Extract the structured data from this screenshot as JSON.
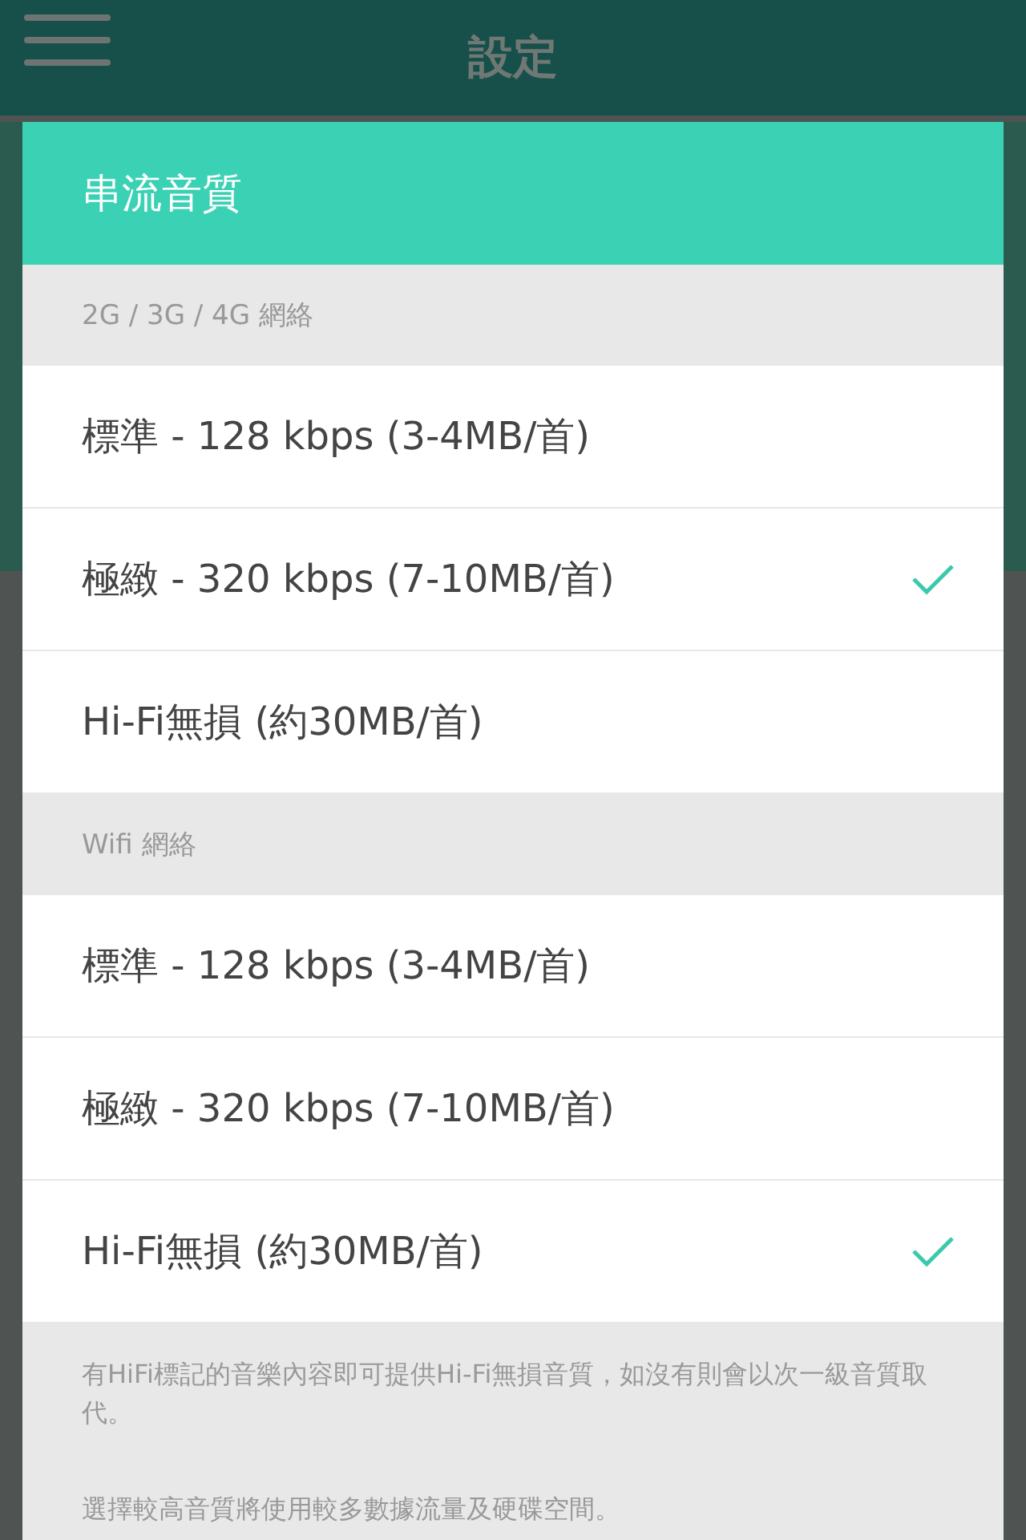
{
  "app_bar": {
    "title": "設定"
  },
  "dialog": {
    "title": "串流音質",
    "sections": [
      {
        "header": "2G / 3G / 4G 網絡",
        "options": [
          {
            "label": "標準 - 128 kbps (3-4MB/首)",
            "selected": false
          },
          {
            "label": "極緻 - 320 kbps (7-10MB/首)",
            "selected": true
          },
          {
            "label": "Hi-Fi無損 (約30MB/首)",
            "selected": false
          }
        ]
      },
      {
        "header": "Wifi 網絡",
        "options": [
          {
            "label": "標準 - 128 kbps (3-4MB/首)",
            "selected": false
          },
          {
            "label": "極緻 - 320 kbps (7-10MB/首)",
            "selected": false
          },
          {
            "label": "Hi-Fi無損 (約30MB/首)",
            "selected": true
          }
        ]
      }
    ],
    "notes": [
      "有HiFi標記的音樂內容即可提供Hi-Fi無損音質，如沒有則會以次一級音質取代。",
      "選擇較高音質將使用較多數據流量及硬碟空間。"
    ]
  }
}
